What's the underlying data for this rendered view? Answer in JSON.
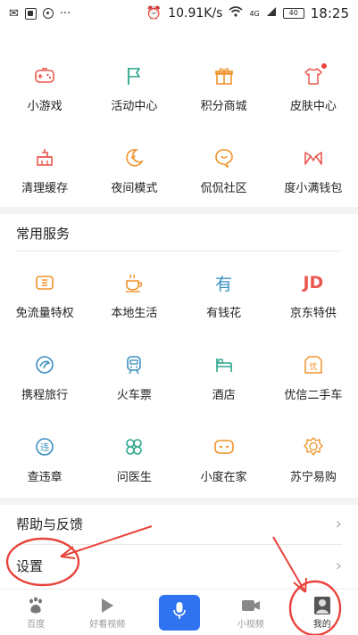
{
  "statusbar": {
    "speed": "10.91K/s",
    "signal": "4G",
    "battery": "40",
    "time": "18:25"
  },
  "grid_top": [
    {
      "label": "小游戏",
      "icon": "gamepad-icon"
    },
    {
      "label": "活动中心",
      "icon": "flag-icon"
    },
    {
      "label": "积分商城",
      "icon": "gift-icon"
    },
    {
      "label": "皮肤中心",
      "icon": "shirt-icon"
    },
    {
      "label": "清理缓存",
      "icon": "broom-icon"
    },
    {
      "label": "夜间模式",
      "icon": "moon-icon"
    },
    {
      "label": "侃侃社区",
      "icon": "chat-bubble-icon"
    },
    {
      "label": "度小满钱包",
      "icon": "wallet-icon"
    }
  ],
  "services": {
    "title": "常用服务",
    "items": [
      {
        "label": "免流量特权",
        "icon": "data-card-icon"
      },
      {
        "label": "本地生活",
        "icon": "coffee-cup-icon"
      },
      {
        "label": "有钱花",
        "icon": "money-char-icon"
      },
      {
        "label": "京东特供",
        "icon": "jd-logo-icon"
      },
      {
        "label": "携程旅行",
        "icon": "dolphin-icon"
      },
      {
        "label": "火车票",
        "icon": "train-icon"
      },
      {
        "label": "酒店",
        "icon": "hotel-bed-icon"
      },
      {
        "label": "优信二手车",
        "icon": "car-tag-icon"
      },
      {
        "label": "查违章",
        "icon": "violation-icon"
      },
      {
        "label": "问医生",
        "icon": "clover-icon"
      },
      {
        "label": "小度在家",
        "icon": "smart-speaker-icon"
      },
      {
        "label": "苏宁易购",
        "icon": "lion-icon"
      }
    ]
  },
  "menu": {
    "help": "帮助与反馈",
    "settings": "设置"
  },
  "tabs": [
    {
      "label": "百度",
      "icon": "paw-icon"
    },
    {
      "label": "好看视频",
      "icon": "play-icon"
    },
    {
      "label": "",
      "icon": "microphone-icon"
    },
    {
      "label": "小视频",
      "icon": "video-icon"
    },
    {
      "label": "我的",
      "icon": "avatar-icon"
    }
  ],
  "colors": {
    "accent_blue": "#2f73f0",
    "red_annotation": "#e8433b",
    "orange": "#f0932b",
    "teal": "#2aa58c"
  }
}
